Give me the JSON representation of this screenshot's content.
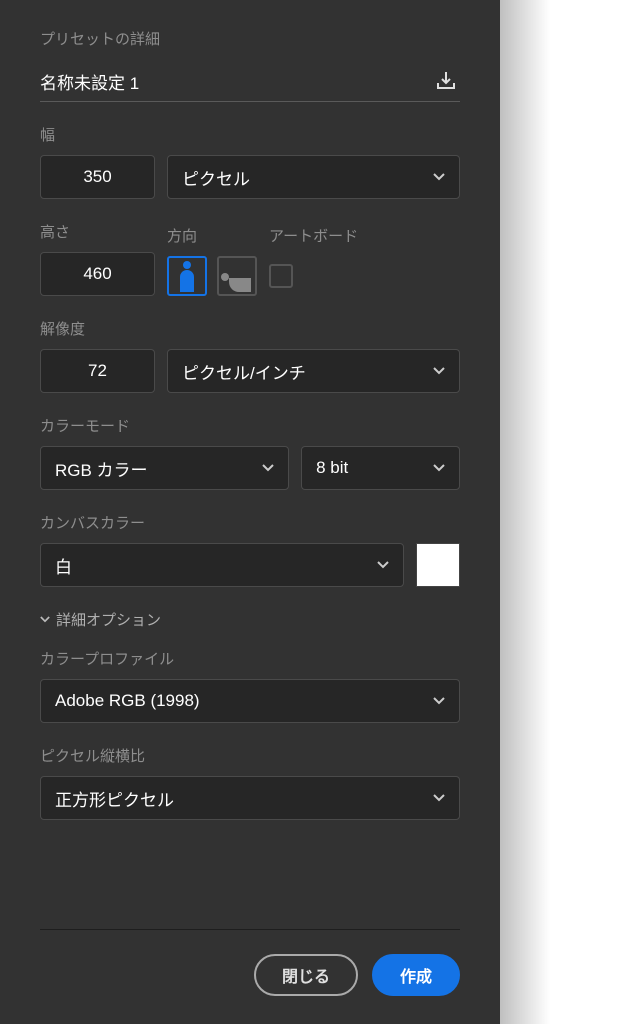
{
  "header": {
    "title": "プリセットの詳細",
    "document_name": "名称未設定 1"
  },
  "width": {
    "label": "幅",
    "value": "350",
    "unit": "ピクセル"
  },
  "height": {
    "label": "高さ",
    "value": "460"
  },
  "orientation": {
    "label": "方向"
  },
  "artboard": {
    "label": "アートボード",
    "checked": false
  },
  "resolution": {
    "label": "解像度",
    "value": "72",
    "unit": "ピクセル/インチ"
  },
  "color_mode": {
    "label": "カラーモード",
    "mode": "RGB カラー",
    "depth": "8 bit"
  },
  "canvas_color": {
    "label": "カンバスカラー",
    "value": "白",
    "swatch_hex": "#ffffff"
  },
  "advanced": {
    "toggle_label": "詳細オプション"
  },
  "color_profile": {
    "label": "カラープロファイル",
    "value": "Adobe RGB (1998)"
  },
  "pixel_aspect": {
    "label": "ピクセル縦横比",
    "value": "正方形ピクセル"
  },
  "footer": {
    "close": "閉じる",
    "create": "作成"
  }
}
